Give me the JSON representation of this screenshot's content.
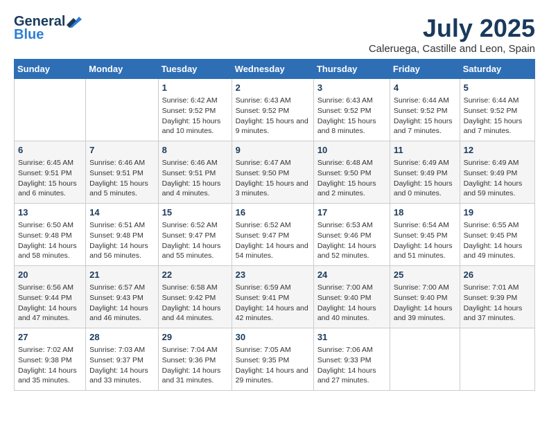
{
  "logo": {
    "general": "General",
    "blue": "Blue"
  },
  "title": {
    "month_year": "July 2025",
    "location": "Caleruega, Castille and Leon, Spain"
  },
  "days_of_week": [
    "Sunday",
    "Monday",
    "Tuesday",
    "Wednesday",
    "Thursday",
    "Friday",
    "Saturday"
  ],
  "weeks": [
    [
      {
        "day": "",
        "info": ""
      },
      {
        "day": "",
        "info": ""
      },
      {
        "day": "1",
        "info": "Sunrise: 6:42 AM\nSunset: 9:52 PM\nDaylight: 15 hours and 10 minutes."
      },
      {
        "day": "2",
        "info": "Sunrise: 6:43 AM\nSunset: 9:52 PM\nDaylight: 15 hours and 9 minutes."
      },
      {
        "day": "3",
        "info": "Sunrise: 6:43 AM\nSunset: 9:52 PM\nDaylight: 15 hours and 8 minutes."
      },
      {
        "day": "4",
        "info": "Sunrise: 6:44 AM\nSunset: 9:52 PM\nDaylight: 15 hours and 7 minutes."
      },
      {
        "day": "5",
        "info": "Sunrise: 6:44 AM\nSunset: 9:52 PM\nDaylight: 15 hours and 7 minutes."
      }
    ],
    [
      {
        "day": "6",
        "info": "Sunrise: 6:45 AM\nSunset: 9:51 PM\nDaylight: 15 hours and 6 minutes."
      },
      {
        "day": "7",
        "info": "Sunrise: 6:46 AM\nSunset: 9:51 PM\nDaylight: 15 hours and 5 minutes."
      },
      {
        "day": "8",
        "info": "Sunrise: 6:46 AM\nSunset: 9:51 PM\nDaylight: 15 hours and 4 minutes."
      },
      {
        "day": "9",
        "info": "Sunrise: 6:47 AM\nSunset: 9:50 PM\nDaylight: 15 hours and 3 minutes."
      },
      {
        "day": "10",
        "info": "Sunrise: 6:48 AM\nSunset: 9:50 PM\nDaylight: 15 hours and 2 minutes."
      },
      {
        "day": "11",
        "info": "Sunrise: 6:49 AM\nSunset: 9:49 PM\nDaylight: 15 hours and 0 minutes."
      },
      {
        "day": "12",
        "info": "Sunrise: 6:49 AM\nSunset: 9:49 PM\nDaylight: 14 hours and 59 minutes."
      }
    ],
    [
      {
        "day": "13",
        "info": "Sunrise: 6:50 AM\nSunset: 9:48 PM\nDaylight: 14 hours and 58 minutes."
      },
      {
        "day": "14",
        "info": "Sunrise: 6:51 AM\nSunset: 9:48 PM\nDaylight: 14 hours and 56 minutes."
      },
      {
        "day": "15",
        "info": "Sunrise: 6:52 AM\nSunset: 9:47 PM\nDaylight: 14 hours and 55 minutes."
      },
      {
        "day": "16",
        "info": "Sunrise: 6:52 AM\nSunset: 9:47 PM\nDaylight: 14 hours and 54 minutes."
      },
      {
        "day": "17",
        "info": "Sunrise: 6:53 AM\nSunset: 9:46 PM\nDaylight: 14 hours and 52 minutes."
      },
      {
        "day": "18",
        "info": "Sunrise: 6:54 AM\nSunset: 9:45 PM\nDaylight: 14 hours and 51 minutes."
      },
      {
        "day": "19",
        "info": "Sunrise: 6:55 AM\nSunset: 9:45 PM\nDaylight: 14 hours and 49 minutes."
      }
    ],
    [
      {
        "day": "20",
        "info": "Sunrise: 6:56 AM\nSunset: 9:44 PM\nDaylight: 14 hours and 47 minutes."
      },
      {
        "day": "21",
        "info": "Sunrise: 6:57 AM\nSunset: 9:43 PM\nDaylight: 14 hours and 46 minutes."
      },
      {
        "day": "22",
        "info": "Sunrise: 6:58 AM\nSunset: 9:42 PM\nDaylight: 14 hours and 44 minutes."
      },
      {
        "day": "23",
        "info": "Sunrise: 6:59 AM\nSunset: 9:41 PM\nDaylight: 14 hours and 42 minutes."
      },
      {
        "day": "24",
        "info": "Sunrise: 7:00 AM\nSunset: 9:40 PM\nDaylight: 14 hours and 40 minutes."
      },
      {
        "day": "25",
        "info": "Sunrise: 7:00 AM\nSunset: 9:40 PM\nDaylight: 14 hours and 39 minutes."
      },
      {
        "day": "26",
        "info": "Sunrise: 7:01 AM\nSunset: 9:39 PM\nDaylight: 14 hours and 37 minutes."
      }
    ],
    [
      {
        "day": "27",
        "info": "Sunrise: 7:02 AM\nSunset: 9:38 PM\nDaylight: 14 hours and 35 minutes."
      },
      {
        "day": "28",
        "info": "Sunrise: 7:03 AM\nSunset: 9:37 PM\nDaylight: 14 hours and 33 minutes."
      },
      {
        "day": "29",
        "info": "Sunrise: 7:04 AM\nSunset: 9:36 PM\nDaylight: 14 hours and 31 minutes."
      },
      {
        "day": "30",
        "info": "Sunrise: 7:05 AM\nSunset: 9:35 PM\nDaylight: 14 hours and 29 minutes."
      },
      {
        "day": "31",
        "info": "Sunrise: 7:06 AM\nSunset: 9:33 PM\nDaylight: 14 hours and 27 minutes."
      },
      {
        "day": "",
        "info": ""
      },
      {
        "day": "",
        "info": ""
      }
    ]
  ]
}
